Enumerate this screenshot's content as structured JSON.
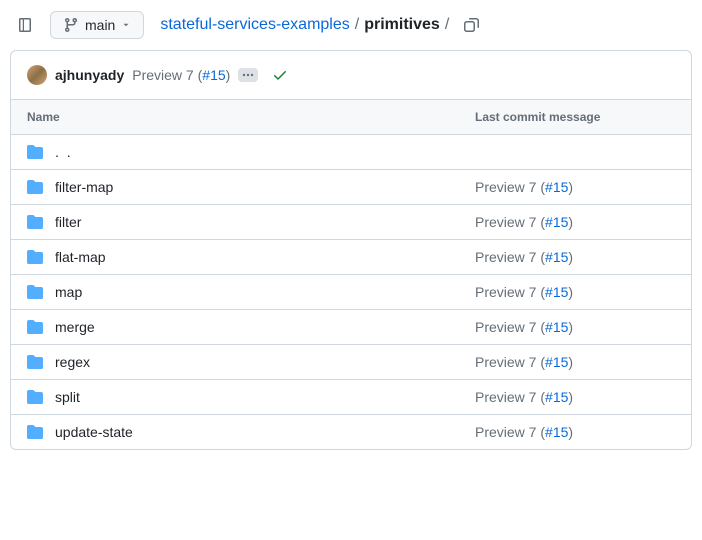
{
  "branch": {
    "name": "main"
  },
  "breadcrumb": {
    "repo": "stateful-services-examples",
    "current": "primitives",
    "sep": "/"
  },
  "commit": {
    "author": "ajhunyady",
    "message_prefix": "Preview 7 (",
    "pr_text": "#15",
    "message_suffix": ")"
  },
  "table": {
    "header_name": "Name",
    "header_msg": "Last commit message",
    "parent": ". ."
  },
  "rows": [
    {
      "name": "filter-map",
      "msg_prefix": "Preview 7 (",
      "pr": "#15",
      "msg_suffix": ")"
    },
    {
      "name": "filter",
      "msg_prefix": "Preview 7 (",
      "pr": "#15",
      "msg_suffix": ")"
    },
    {
      "name": "flat-map",
      "msg_prefix": "Preview 7 (",
      "pr": "#15",
      "msg_suffix": ")"
    },
    {
      "name": "map",
      "msg_prefix": "Preview 7 (",
      "pr": "#15",
      "msg_suffix": ")"
    },
    {
      "name": "merge",
      "msg_prefix": "Preview 7 (",
      "pr": "#15",
      "msg_suffix": ")"
    },
    {
      "name": "regex",
      "msg_prefix": "Preview 7 (",
      "pr": "#15",
      "msg_suffix": ")"
    },
    {
      "name": "split",
      "msg_prefix": "Preview 7 (",
      "pr": "#15",
      "msg_suffix": ")"
    },
    {
      "name": "update-state",
      "msg_prefix": "Preview 7 (",
      "pr": "#15",
      "msg_suffix": ")"
    }
  ]
}
